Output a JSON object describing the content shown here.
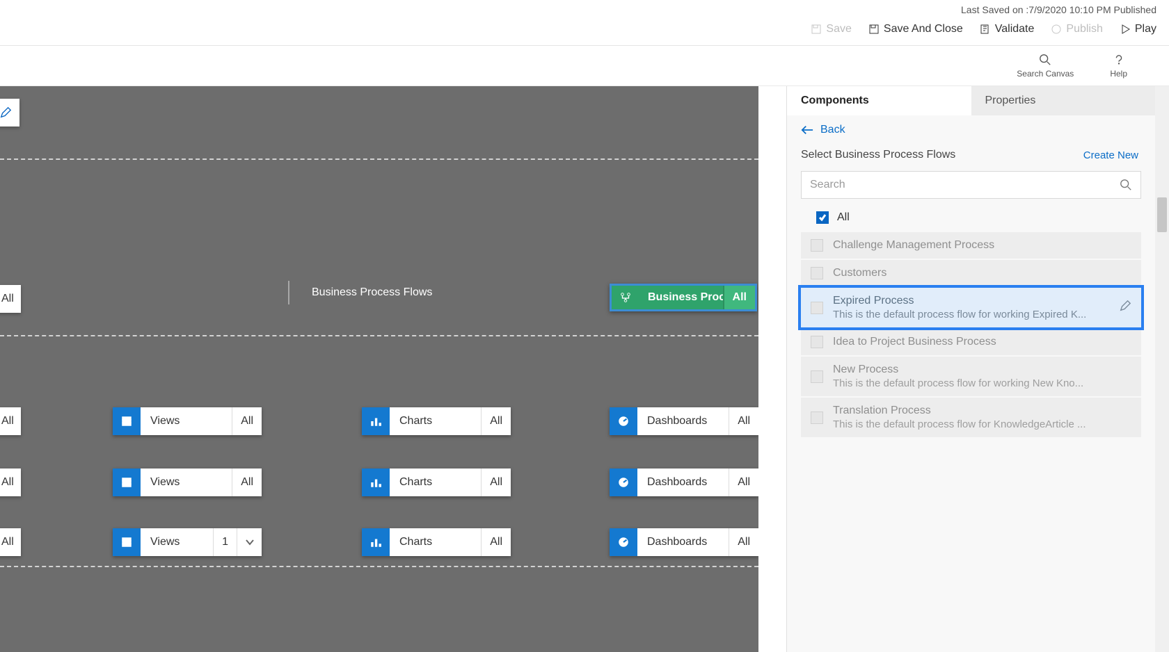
{
  "header": {
    "last_saved": "Last Saved on :7/9/2020 10:10 PM Published",
    "actions": {
      "save": "Save",
      "save_close": "Save And Close",
      "validate": "Validate",
      "publish": "Publish",
      "play": "Play"
    }
  },
  "toolbar": {
    "search_canvas": "Search Canvas",
    "help": "Help"
  },
  "canvas": {
    "bpf_label": "Business Process Flows",
    "selected": {
      "label": "Business Proces...",
      "tag": "All"
    },
    "edge_all": "All",
    "rows": [
      {
        "views": {
          "label": "Views",
          "tag": "All"
        },
        "charts": {
          "label": "Charts",
          "tag": "All"
        },
        "dash": {
          "label": "Dashboards",
          "tag": "All"
        }
      },
      {
        "views": {
          "label": "Views",
          "tag": "All"
        },
        "charts": {
          "label": "Charts",
          "tag": "All"
        },
        "dash": {
          "label": "Dashboards",
          "tag": "All"
        }
      },
      {
        "views": {
          "label": "Views",
          "tag": "1"
        },
        "charts": {
          "label": "Charts",
          "tag": "All"
        },
        "dash": {
          "label": "Dashboards",
          "tag": "All"
        }
      }
    ]
  },
  "panel": {
    "tabs": {
      "components": "Components",
      "properties": "Properties"
    },
    "back": "Back",
    "title": "Select Business Process Flows",
    "create_new": "Create New",
    "search_placeholder": "Search",
    "all_label": "All",
    "items": [
      {
        "name": "Challenge Management Process",
        "desc": ""
      },
      {
        "name": "Customers",
        "desc": ""
      },
      {
        "name": "Expired Process",
        "desc": "This is the default process flow for working Expired K...",
        "highlight": true
      },
      {
        "name": "Idea to Project Business Process",
        "desc": ""
      },
      {
        "name": "New Process",
        "desc": "This is the default process flow for working New Kno..."
      },
      {
        "name": "Translation Process",
        "desc": "This is the default process flow for KnowledgeArticle ..."
      }
    ]
  }
}
